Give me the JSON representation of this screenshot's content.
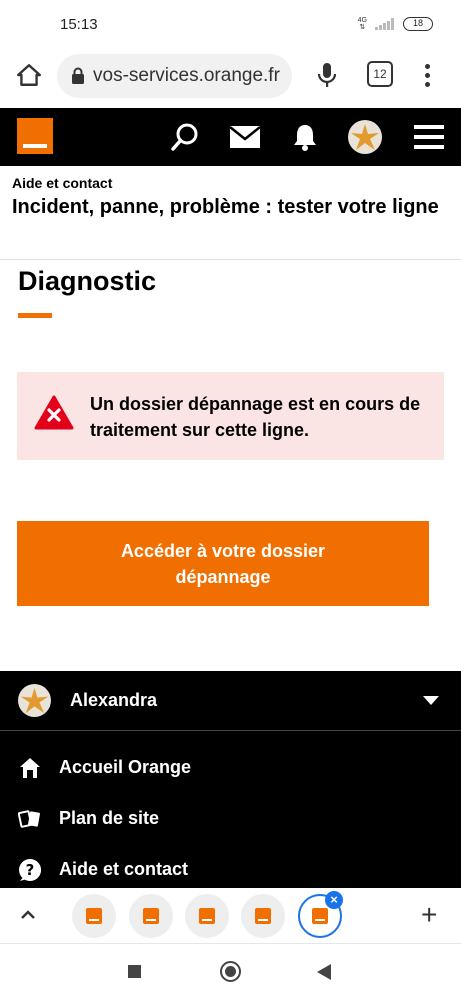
{
  "status_bar": {
    "time": "15:13",
    "network": "4G",
    "battery": "18"
  },
  "browser": {
    "url": "vos-services.orange.fr",
    "tab_count": "12"
  },
  "breadcrumb": {
    "parent": "Aide et contact",
    "title": "Incident, panne, problème : tester votre ligne"
  },
  "main": {
    "title": "Diagnostic",
    "alert_text": "Un dossier dépannage est en cours de traitement sur cette ligne.",
    "cta_label": "Accéder à votre dossier dépannage"
  },
  "footer": {
    "user_name": "Alexandra",
    "items": [
      {
        "label": "Accueil Orange",
        "icon": "home-icon"
      },
      {
        "label": "Plan de site",
        "icon": "sitemap-icon"
      },
      {
        "label": "Aide et contact",
        "icon": "help-icon"
      }
    ]
  },
  "colors": {
    "brand_orange": "#f16e00",
    "alert_bg": "#fbe4e4",
    "alert_red": "#e2001a",
    "active_tab_blue": "#1a73e8"
  }
}
